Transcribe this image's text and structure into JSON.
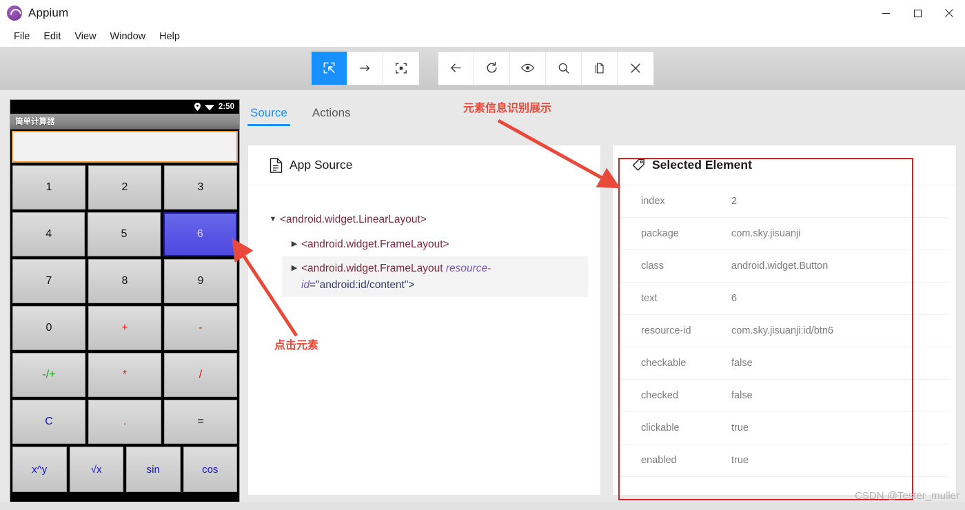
{
  "window": {
    "title": "Appium",
    "logo_icon": "appium-logo-icon",
    "minimize_icon": "minimize-icon",
    "maximize_icon": "maximize-icon",
    "close_icon": "close-icon"
  },
  "menubar": {
    "items": [
      {
        "label": "File"
      },
      {
        "label": "Edit"
      },
      {
        "label": "View"
      },
      {
        "label": "Window"
      },
      {
        "label": "Help"
      }
    ]
  },
  "toolbar": {
    "group_left": [
      {
        "name": "select-element-icon",
        "label": "Select Element",
        "active": true
      },
      {
        "name": "swipe-by-coordinates-icon",
        "label": "Swipe By Coordinates",
        "active": false
      },
      {
        "name": "tap-by-coordinates-icon",
        "label": "Tap By Coordinates",
        "active": false
      }
    ],
    "group_right": [
      {
        "name": "back-icon",
        "label": "Back",
        "active": false
      },
      {
        "name": "refresh-icon",
        "label": "Refresh Source",
        "active": false
      },
      {
        "name": "eye-icon",
        "label": "Show/Hide Centroids",
        "active": false
      },
      {
        "name": "search-icon",
        "label": "Search for Element",
        "active": false
      },
      {
        "name": "copy-icon",
        "label": "Copy XML Source",
        "active": false
      },
      {
        "name": "close-session-icon",
        "label": "Quit Session",
        "active": false
      }
    ]
  },
  "device": {
    "statusbar": {
      "location_icon": "location-pin-icon",
      "wifi_icon": "wifi-icon",
      "time": "2:50"
    },
    "app_title": "简单计算器",
    "display_value": "",
    "keypad_rows": [
      [
        {
          "label": "1",
          "style": "num",
          "selected": false
        },
        {
          "label": "2",
          "style": "num",
          "selected": false
        },
        {
          "label": "3",
          "style": "num",
          "selected": false
        }
      ],
      [
        {
          "label": "4",
          "style": "num",
          "selected": false
        },
        {
          "label": "5",
          "style": "num",
          "selected": false
        },
        {
          "label": "6",
          "style": "num",
          "selected": true
        }
      ],
      [
        {
          "label": "7",
          "style": "num",
          "selected": false
        },
        {
          "label": "8",
          "style": "num",
          "selected": false
        },
        {
          "label": "9",
          "style": "num",
          "selected": false
        }
      ],
      [
        {
          "label": "0",
          "style": "num",
          "selected": false
        },
        {
          "label": "+",
          "style": "op-red",
          "selected": false
        },
        {
          "label": "-",
          "style": "op-red",
          "selected": false
        }
      ],
      [
        {
          "label": "-/+",
          "style": "op-green",
          "selected": false
        },
        {
          "label": "*",
          "style": "op-red",
          "selected": false
        },
        {
          "label": "/",
          "style": "op-red",
          "selected": false
        }
      ],
      [
        {
          "label": "C",
          "style": "op-blue",
          "selected": false
        },
        {
          "label": ".",
          "style": "op-red",
          "selected": false
        },
        {
          "label": "=",
          "style": "num",
          "selected": false
        }
      ],
      [
        {
          "label": "x^y",
          "style": "op-blue",
          "selected": false
        },
        {
          "label": "√x",
          "style": "op-blue",
          "selected": false
        },
        {
          "label": "sin",
          "style": "op-blue",
          "selected": false
        },
        {
          "label": "cos",
          "style": "op-blue",
          "selected": false
        }
      ]
    ]
  },
  "inspector": {
    "tabs": [
      {
        "label": "Source",
        "active": true
      },
      {
        "label": "Actions",
        "active": false
      }
    ],
    "app_source": {
      "icon": "document-icon",
      "title": "App Source",
      "tree": [
        {
          "caret": "▼",
          "expanded": true,
          "indent": 1,
          "highlighted": false,
          "text": "<android.widget.LinearLayout>"
        },
        {
          "caret": "▶",
          "expanded": false,
          "indent": 2,
          "highlighted": false,
          "text": "<android.widget.FrameLayout>"
        },
        {
          "caret": "▶",
          "expanded": false,
          "indent": 2,
          "highlighted": true,
          "text_prefix": "<android.widget.FrameLayout ",
          "text_attr": "resource-id",
          "text_suffix": "=\"android:id/content\">"
        }
      ]
    }
  },
  "selected_element": {
    "icon": "tag-icon",
    "title": "Selected Element",
    "attributes": [
      {
        "key": "index",
        "value": "2"
      },
      {
        "key": "package",
        "value": "com.sky.jisuanji"
      },
      {
        "key": "class",
        "value": "android.widget.Button"
      },
      {
        "key": "text",
        "value": "6"
      },
      {
        "key": "resource-id",
        "value": "com.sky.jisuanji:id/btn6"
      },
      {
        "key": "checkable",
        "value": "false"
      },
      {
        "key": "checked",
        "value": "false"
      },
      {
        "key": "clickable",
        "value": "true"
      },
      {
        "key": "enabled",
        "value": "true"
      }
    ]
  },
  "annotations": {
    "top_label": "元素信息识别展示",
    "left_label": "点击元素",
    "color": "#e8493a"
  },
  "watermark": "CSDN @Tester_muller",
  "colors": {
    "accent": "#1890ff",
    "selected_key": "#5a56e6",
    "annotation_red": "#e02020",
    "display_border": "#f0a030"
  }
}
